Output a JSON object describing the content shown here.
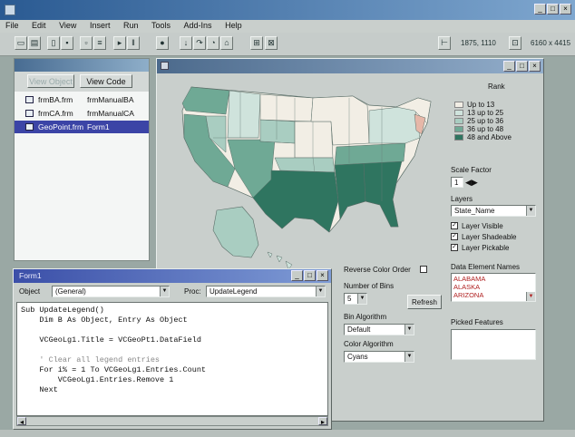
{
  "app": {
    "title": "",
    "controls": [
      "_",
      "□",
      "×"
    ]
  },
  "menu": [
    "File",
    "Edit",
    "View",
    "Insert",
    "Run",
    "Tools",
    "Add-Ins",
    "Help"
  ],
  "toolbar": {
    "coord_a": "1875, 1110",
    "coord_b": "6160 x 4415"
  },
  "project": {
    "title": "",
    "view_object": "View Object",
    "view_code": "View Code",
    "items": [
      {
        "file": "frmBA.frm",
        "form": "frmManualBA"
      },
      {
        "file": "frmCA.frm",
        "form": "frmManualCA"
      },
      {
        "file": "GeoPoint.frm",
        "form": "Form1"
      }
    ]
  },
  "map_window": {
    "title": "",
    "controls": [
      "_",
      "□",
      "×"
    ],
    "legend": {
      "title": "Rank",
      "items": [
        {
          "label": "Up to 13",
          "color": "#f2eee5"
        },
        {
          "label": "13 up to 25",
          "color": "#cfe3dc"
        },
        {
          "label": "25 up to 36",
          "color": "#a9cdc1"
        },
        {
          "label": "36 up to 48",
          "color": "#6fa995"
        },
        {
          "label": "48 and Above",
          "color": "#2f7560"
        }
      ]
    },
    "scale_factor_label": "Scale Factor",
    "scale_factor_value": "1",
    "layers_label": "Layers",
    "layer_value": "State_Name",
    "checks": [
      {
        "label": "Layer Visible",
        "checked": true
      },
      {
        "label": "Layer Shadeable",
        "checked": true
      },
      {
        "label": "Layer Pickable",
        "checked": true
      }
    ],
    "data_elements_label": "Data Element Names",
    "data_elements": [
      "ALABAMA",
      "ALASKA",
      "ARIZONA"
    ],
    "picked_label": "Picked Features",
    "reverse_color": "Reverse Color Order",
    "bins_label": "Number of Bins",
    "bins_value": "5",
    "refresh": "Refresh",
    "bin_algo_label": "Bin Algorithm",
    "bin_algo_value": "Default",
    "color_algo_label": "Color Algorithm",
    "color_algo_value": "Cyans"
  },
  "code_window": {
    "title": "Form1",
    "object_label": "Object",
    "object_value": "(General)",
    "proc_label": "Proc:",
    "proc_value": "UpdateLegend",
    "lines": [
      "Sub UpdateLegend()",
      "    Dim B As Object, Entry As Object",
      "",
      "    VCGeoLg1.Title = VCGeoPt1.DataField",
      "",
      "    ' Clear all legend entries",
      "    For i% = 1 To VCGeoLg1.Entries.Count",
      "        VCGeoLg1.Entries.Remove 1",
      "    Next"
    ]
  }
}
